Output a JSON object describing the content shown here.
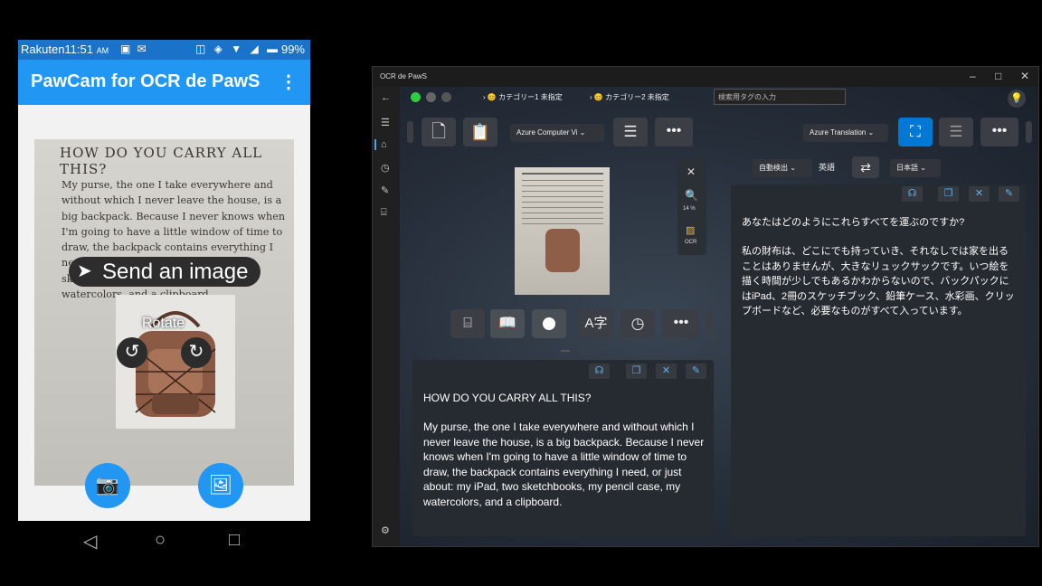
{
  "phone": {
    "status": {
      "carrier": "Rakuten",
      "time": "11:51",
      "ampm": "AM",
      "battery": "99%"
    },
    "appbar": {
      "title": "PawCam for OCR de PawS",
      "menu_glyph": "⋮"
    },
    "photo": {
      "heading": "HOW DO YOU CARRY ALL THIS?",
      "body": "My purse, the one I take everywhere and without which I never leave the house, is a big backpack. Because I never knows when I'm going to have a little window of time to draw, the backpack contains everything I need, or just about: my iPad, two sketchbooks, my pencil case, my watercolors, and a clipboard."
    },
    "send_label": "Send an image",
    "rotate_label": "Rotate",
    "icons": {
      "send": "send-icon",
      "rotate_left": "rotate-left-icon",
      "rotate_right": "rotate-right-icon",
      "camera": "add-camera-icon",
      "gallery": "image-search-icon",
      "back": "back-icon",
      "home": "home-icon",
      "recents": "recents-icon"
    }
  },
  "desktop": {
    "window_title": "OCR de PawS",
    "category1": "カテゴリー1 未指定",
    "category2": "カテゴリー2 未指定",
    "tag_search_placeholder": "検索用タグの入力",
    "ocr_engine": "Azure Computer Vi",
    "translation_engine": "Azure Translation",
    "source_lang": "自動検出",
    "detected_lang": "英語",
    "target_lang": "日本語",
    "zoom": "14 %",
    "ocr_label": "OCR",
    "ocr_text_title": "HOW DO YOU CARRY ALL THIS?",
    "ocr_text_body": "My purse, the one I take everywhere and without which I never leave the house, is a big backpack. Because I never knows when I'm going to have a little window of time to draw, the backpack contains everything I need, or just about: my iPad, two sketchbooks, my pencil case, my watercolors, and a clipboard.",
    "translation_title": "あなたはどのようにこれらすべてを運ぶのですか?",
    "translation_body": "私の財布は、どこにでも持っていき、それなしでは家を出ることはありませんが、大きなリュックサックです。いつ絵を描く時間が少しでもあるかわからないので、バックパックにはiPad、2冊のスケッチブック、鉛筆ケース、水彩画、クリップボードなど、必要なものがすべて入っています。",
    "colors": {
      "accent": "#0078d4",
      "link_icon": "#5bb3f0",
      "traffic_green": "#2ecc40"
    }
  }
}
